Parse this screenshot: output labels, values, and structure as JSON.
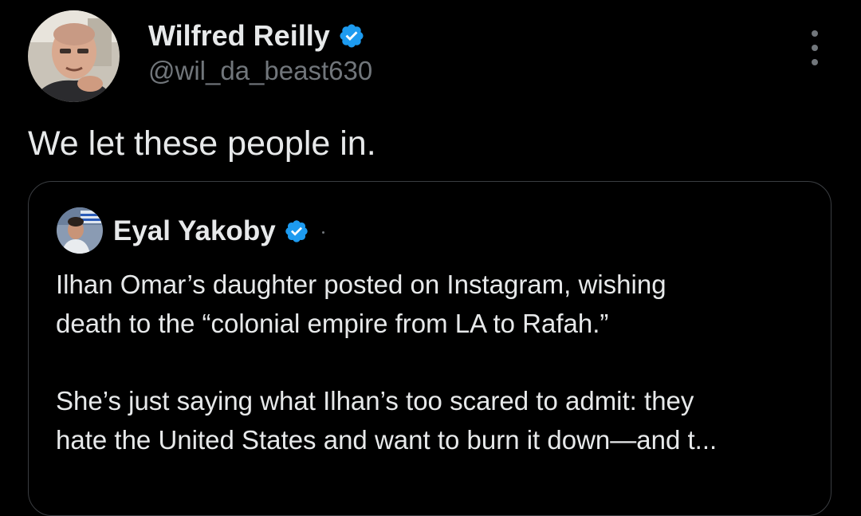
{
  "tweet": {
    "author": {
      "name": "Wilfred Reilly",
      "handle": "@wil_da_beast630",
      "verified": true
    },
    "text": "We let these people in.",
    "more_icon": "more-vertical-icon"
  },
  "quoted_tweet": {
    "author": {
      "name": "Eyal Yakoby",
      "verified": true
    },
    "paragraphs": [
      {
        "lines": [
          "Ilhan Omar’s daughter posted on Instagram, wishing",
          "death to the “colonial empire from LA to Rafah.”"
        ]
      },
      {
        "lines": [
          "She’s just saying what Ilhan’s too scared to admit: they",
          "hate the United States and want to burn it down—and t..."
        ]
      }
    ]
  },
  "colors": {
    "background": "#000000",
    "text_primary": "#e7e9ea",
    "text_secondary": "#71767b",
    "verified_badge": "#1d9bf0",
    "card_border": "#3a3d41"
  }
}
